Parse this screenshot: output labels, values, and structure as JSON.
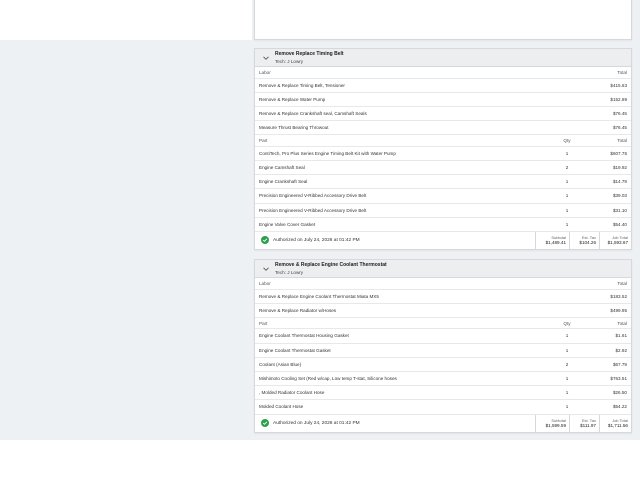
{
  "jobs": [
    {
      "title": "Remove Replace Timing Belt",
      "tech": "Tech: J Lowry",
      "labor_header": {
        "desc": "Labor",
        "total": "Total"
      },
      "labor": [
        {
          "desc": "Remove & Replace Timing Belt, Tensioner",
          "total": "$415.63"
        },
        {
          "desc": "Remove & Replace Water Pump",
          "total": "$152.89"
        },
        {
          "desc": "Remove & Replace Crankshaft seal, Camshaft Seals",
          "total": "$76.45"
        },
        {
          "desc": "Measure Thrust Bearing Throwout",
          "total": "$76.45"
        }
      ],
      "part_header": {
        "desc": "Part",
        "qty": "Qty",
        "total": "Total"
      },
      "parts": [
        {
          "desc": "ContiTech, Pro Plus Series Engine Timing Belt Kit with Water Pump",
          "qty": "1",
          "total": "$607.75"
        },
        {
          "desc": "Engine Camshaft Seal",
          "qty": "2",
          "total": "$19.92"
        },
        {
          "desc": "Engine Crankshaft Seal",
          "qty": "1",
          "total": "$14.79"
        },
        {
          "desc": "Precision Engineered V-Ribbed Accessory Drive Belt",
          "qty": "1",
          "total": "$39.03"
        },
        {
          "desc": "Precision Engineered V-Ribbed Accessory Drive Belt",
          "qty": "1",
          "total": "$31.10"
        },
        {
          "desc": "Engine Valve Cover Gasket",
          "qty": "1",
          "total": "$54.40"
        }
      ],
      "authorized": "Authorized on July 24, 2026 at 01:42 PM",
      "subtotal_label": "Subtotal",
      "subtotal": "$1,489.41",
      "tax_label": "Est. Tax",
      "tax": "$104.26",
      "job_total_label": "Job Total",
      "job_total": "$1,593.67"
    },
    {
      "title": "Remove & Replace Engine Coolant Thermostat",
      "tech": "Tech: J Lowry",
      "labor_header": {
        "desc": "Labor",
        "total": "Total"
      },
      "labor": [
        {
          "desc": "Remove & Replace Engine Coolant Thermostat Miata MX5",
          "total": "$183.52"
        },
        {
          "desc": "Remove & Replace Radiator w/Hoses",
          "total": "$499.95"
        }
      ],
      "part_header": {
        "desc": "Part",
        "qty": "Qty",
        "total": "Total"
      },
      "parts": [
        {
          "desc": "Engine Coolant Thermostat Housing Gasket",
          "qty": "1",
          "total": "$1.61"
        },
        {
          "desc": "Engine Coolant Thermostat Gasket",
          "qty": "1",
          "total": "$2.92"
        },
        {
          "desc": "Coolant (Asian Blue)",
          "qty": "2",
          "total": "$67.79"
        },
        {
          "desc": "Mishimoto Cooling Set (Red w/cap, Low temp T-stat, Silicone hoses",
          "qty": "1",
          "total": "$763.51"
        },
        {
          "desc": ", Molded Radiator Coolant Hose",
          "qty": "1",
          "total": "$26.50"
        },
        {
          "desc": "Molded Coolant Hose",
          "qty": "1",
          "total": "$54.22"
        }
      ],
      "authorized": "Authorized on July 24, 2026 at 01:42 PM",
      "subtotal_label": "Subtotal",
      "subtotal": "$1,599.59",
      "tax_label": "Est. Tax",
      "tax": "$111.97",
      "job_total_label": "Job Total",
      "job_total": "$1,711.56"
    }
  ],
  "colors": {
    "authorized_check": "#2e9f4f",
    "header_bg": "#eceef0",
    "page_bg": "#eef1f4"
  }
}
